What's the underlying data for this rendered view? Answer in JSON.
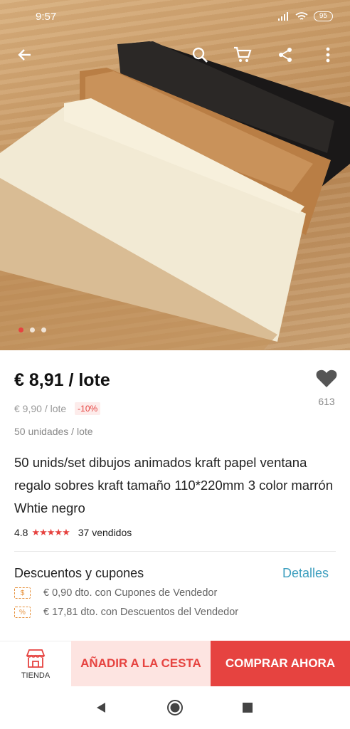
{
  "status_bar": {
    "time": "9:57",
    "battery": "95"
  },
  "gallery": {
    "image_count": 3,
    "active_index": 0
  },
  "icons": {
    "back": "back-arrow-icon",
    "search": "search-icon",
    "cart": "cart-icon",
    "share": "share-icon",
    "more": "more-vert-icon",
    "favorite": "heart-icon",
    "store": "store-icon"
  },
  "product": {
    "price": "€ 8,91 / lote",
    "old_price": "€ 9,90 / lote",
    "discount": "-10%",
    "units": "50 unidades / lote",
    "title": "50 unids/set dibujos animados kraft papel ventana regalo sobres kraft tamaño 110*220mm 3 color marrón Whtie negro",
    "rating": "4.8",
    "stars": "★★★★★",
    "sold": "37 vendidos",
    "favorites_count": "613"
  },
  "coupons": {
    "title": "Descuentos y cupones",
    "details_label": "Detalles",
    "items": [
      {
        "icon_text": "$",
        "text": "€ 0,90 dto. con Cupones de Vendedor"
      },
      {
        "icon_text": "%",
        "text": "€ 17,81 dto. con Descuentos del Vendedor"
      }
    ]
  },
  "actions": {
    "store_label": "TIENDA",
    "add_to_cart": "AÑADIR A LA CESTA",
    "buy_now": "COMPRAR AHORA"
  },
  "colors": {
    "accent": "#e64340",
    "link": "#3d9fbf",
    "coupon": "#e6903a"
  }
}
